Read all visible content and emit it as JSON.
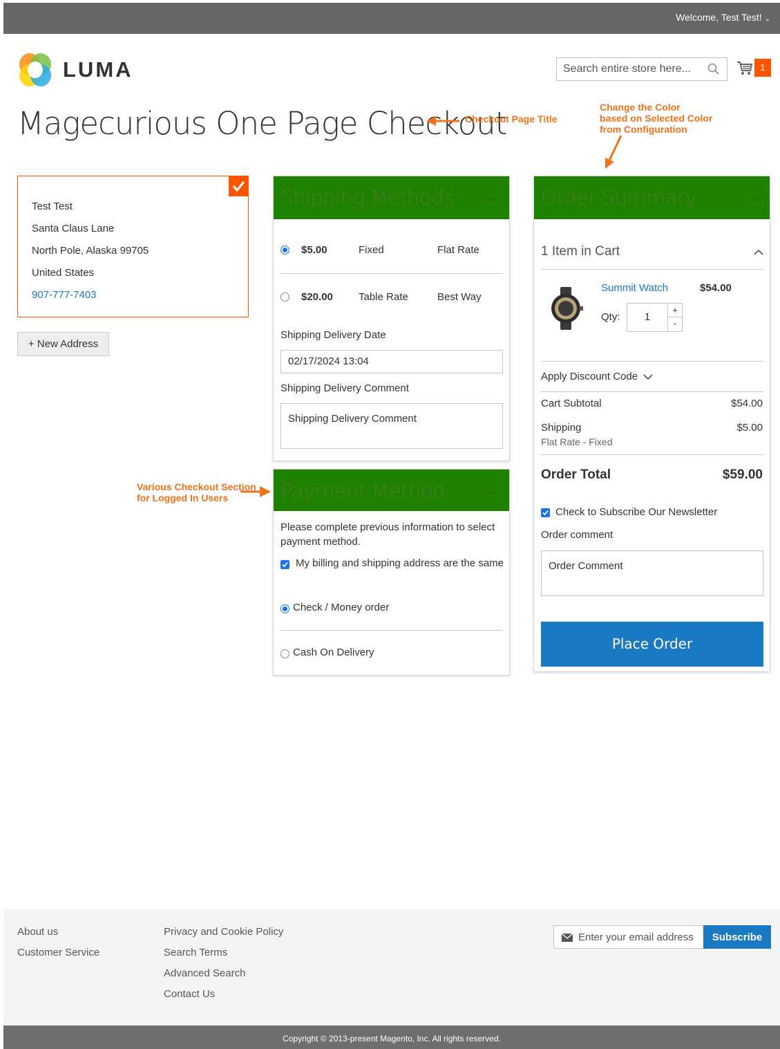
{
  "header": {
    "welcome": "Welcome, Test Test!",
    "logo_text": "LUMA",
    "search_placeholder": "Search entire store here...",
    "cart_count": "1"
  },
  "page_title": "Magecurious One Page Checkout",
  "annotations": {
    "title_note": "Checkout Page Title",
    "color_note_1": "Change the Color",
    "color_note_2": "based on Selected Color",
    "color_note_3": "from Configuration",
    "sections_note_1": "Various Checkout Section",
    "sections_note_2": "for Logged In Users",
    "accent_color": "#f2721c"
  },
  "address": {
    "name": "Test Test",
    "street": "Santa Claus Lane",
    "city_line": "North Pole, Alaska 99705",
    "country": "United States",
    "phone": "907-777-7403",
    "new_address_label": "+ New Address"
  },
  "shipping": {
    "title": "Shipping Methods",
    "collapse": "–",
    "header_color": "#1e8100",
    "methods": [
      {
        "price": "$5.00",
        "method": "Fixed",
        "carrier": "Flat Rate",
        "selected": true
      },
      {
        "price": "$20.00",
        "method": "Table Rate",
        "carrier": "Best Way",
        "selected": false
      }
    ],
    "date_label": "Shipping Delivery Date",
    "date_value": "02/17/2024 13:04",
    "comment_label": "Shipping Delivery Comment",
    "comment_placeholder": "Shipping Delivery Comment"
  },
  "payment": {
    "title": "Payment Method",
    "collapse": "–",
    "notice": "Please complete previous information to select",
    "notice_2": "payment method.",
    "same_address": "My billing and shipping address are the same",
    "methods": [
      {
        "label": "Check / Money order",
        "selected": true
      },
      {
        "label": "Cash On Delivery",
        "selected": false
      }
    ]
  },
  "summary": {
    "title": "Order Summary",
    "collapse": "–",
    "items_in_cart": "1 Item in Cart",
    "item_name": "Summit Watch",
    "item_price": "$54.00",
    "qty_label": "Qty:",
    "qty_value": "1",
    "qty_plus": "+",
    "qty_minus": "-",
    "discount_label": "Apply Discount Code",
    "subtotal_label": "Cart Subtotal",
    "subtotal_value": "$54.00",
    "shipping_label": "Shipping",
    "shipping_method": "Flat Rate - Fixed",
    "shipping_value": "$5.00",
    "total_label": "Order Total",
    "total_value": "$59.00",
    "newsletter_label": "Check to Subscribe Our Newsletter",
    "comment_label": "Order comment",
    "comment_placeholder": "Order Comment",
    "place_order": "Place Order",
    "button_color": "#1979c3"
  },
  "footer": {
    "col1": [
      "About us",
      "Customer Service"
    ],
    "col2": [
      "Privacy and Cookie Policy",
      "Search Terms",
      "Advanced Search",
      "Contact Us"
    ],
    "newsletter_placeholder": "Enter your email address",
    "subscribe": "Subscribe",
    "copyright": "Copyright © 2013-present Magento, Inc. All rights reserved."
  }
}
